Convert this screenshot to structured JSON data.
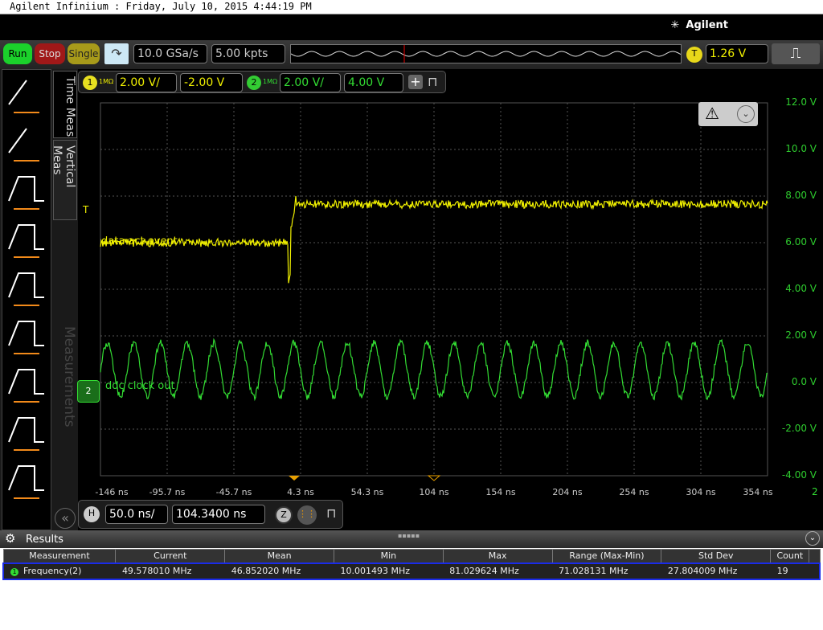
{
  "title": "Agilent Infiniium : Friday, July 10, 2015 4:44:19 PM",
  "brand": "Agilent",
  "toolbar": {
    "run": "Run",
    "stop": "Stop",
    "single": "Single",
    "sample_rate": "10.0 GSa/s",
    "memory_depth": "5.00 kpts",
    "trigger_label": "T",
    "trigger_level": "1.26 V"
  },
  "tabs": {
    "time": "Time Meas",
    "vertical": "Vertical Meas",
    "measurements": "Measurements"
  },
  "channels": [
    {
      "num": "1",
      "imp": "1MΩ",
      "scale": "2.00 V/",
      "offset": "-2.00 V",
      "color": "#f0f000"
    },
    {
      "num": "2",
      "imp": "1MΩ",
      "scale": "2.00 V/",
      "offset": "4.00 V",
      "color": "#33dd33"
    }
  ],
  "waveform_labels": {
    "ch1": "data act event",
    "ch2": "ddc clock out",
    "trigger_marker": "T"
  },
  "y_axis": [
    "12.0 V",
    "10.0 V",
    "8.00 V",
    "6.00 V",
    "4.00 V",
    "2.00 V",
    "0.0 V",
    "-2.00 V",
    "-4.00 V"
  ],
  "x_axis": [
    "-146 ns",
    "-95.7 ns",
    "-45.7 ns",
    "4.3 ns",
    "54.3 ns",
    "104 ns",
    "154 ns",
    "204 ns",
    "254 ns",
    "304 ns",
    "354 ns"
  ],
  "x_axis_channel": "2",
  "horizontal": {
    "label": "H",
    "scale": "50.0 ns/",
    "position": "104.3400 ns",
    "zoom": "Z"
  },
  "results": {
    "title": "Results",
    "columns": [
      "Measurement",
      "Current",
      "Mean",
      "Min",
      "Max",
      "Range (Max-Min)",
      "Std Dev",
      "Count"
    ],
    "rows": [
      {
        "num": "1",
        "cells": [
          "Frequency(2)",
          "49.578010 MHz",
          "46.852020 MHz",
          "10.001493 MHz",
          "81.029624 MHz",
          "71.028131 MHz",
          "27.804009 MHz",
          "19"
        ]
      }
    ]
  }
}
